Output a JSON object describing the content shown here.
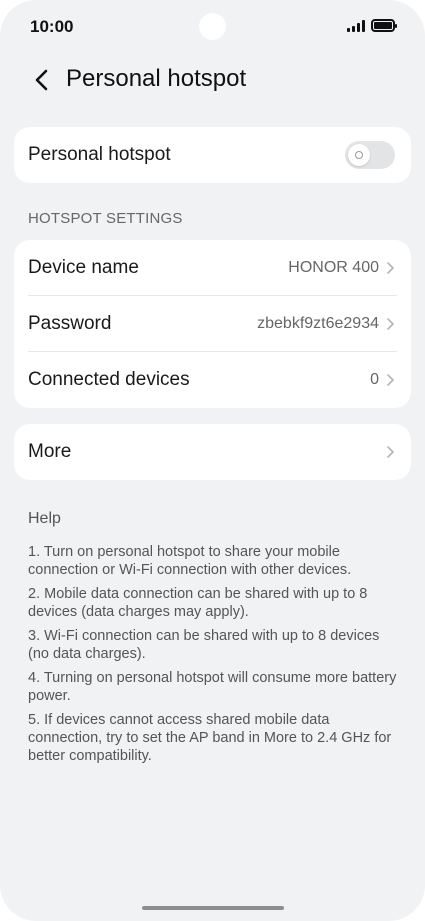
{
  "status_bar": {
    "time": "10:00",
    "icons": [
      "signal-icon",
      "battery-icon"
    ]
  },
  "header": {
    "back_icon": "chevron-left-icon",
    "title": "Personal hotspot"
  },
  "hotspot_card": {
    "label": "Personal hotspot",
    "toggle_on": false
  },
  "settings": {
    "section_title": "HOTSPOT SETTINGS",
    "items": [
      {
        "label": "Device name",
        "value": "HONOR 400"
      },
      {
        "label": "Password",
        "value": "zbebkf9zt6e2934"
      },
      {
        "label": "Connected devices",
        "value": "0"
      }
    ]
  },
  "more": {
    "label": "More"
  },
  "help": {
    "title": "Help",
    "items": [
      "1. Turn on personal hotspot to share your mobile connection or Wi-Fi connection with other devices.",
      "2. Mobile data connection can be shared with up to 8 devices (data charges may apply).",
      "3. Wi-Fi connection can be shared with up to 8 devices (no data charges).",
      "4. Turning on personal hotspot will consume more battery power.",
      "5. If devices cannot access shared mobile data connection, try to set the AP band in More to 2.4 GHz for better compatibility."
    ]
  },
  "colors": {
    "background": "#f1f2f4",
    "card": "#ffffff",
    "text_primary": "#1a1a1a",
    "text_secondary": "#666666"
  }
}
